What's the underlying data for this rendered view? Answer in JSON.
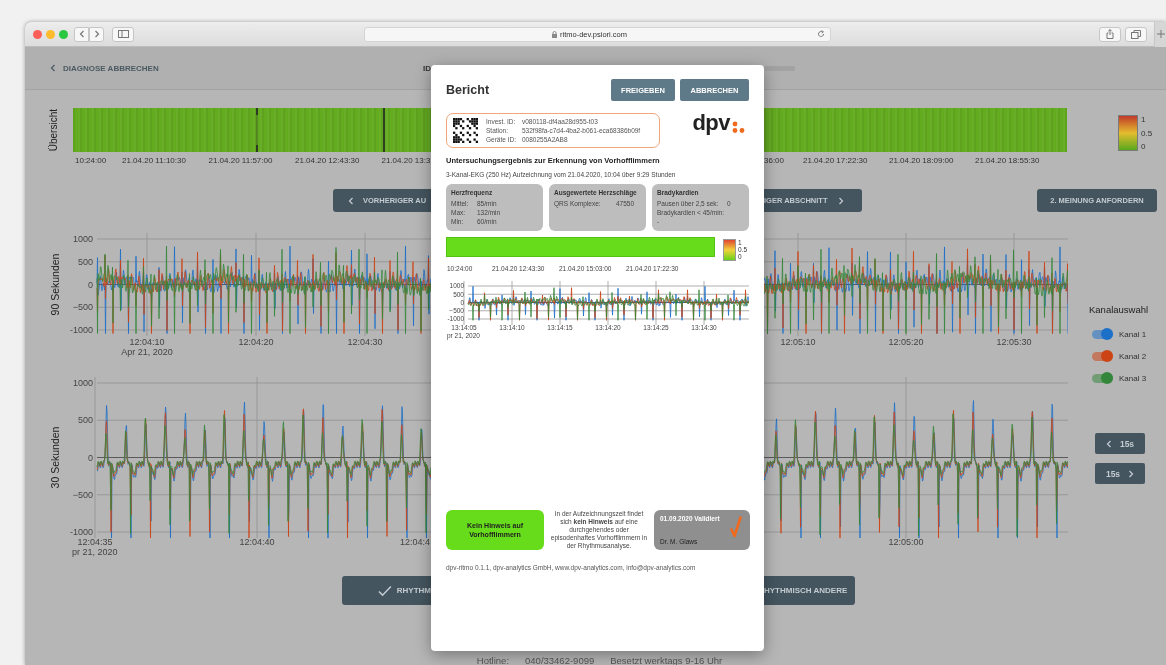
{
  "browser": {
    "url": "ritmo-dev.psiori.com"
  },
  "header": {
    "back_link": "DIAGNOSE ABBRECHEN",
    "id_label": "ID"
  },
  "overview": {
    "label": "Übersicht",
    "time_labels_left": [
      "10:24:00",
      "21.04.20 11:10:30",
      "21.04.20 11:57:00",
      "21.04.20 12:43:30",
      "21.04.20 13:3"
    ],
    "time_labels_right": [
      "36:00",
      "21.04.20 17:22:30",
      "21.04.20 18:09:00",
      "21.04.20 18:55:30"
    ],
    "legend": [
      "1",
      "0.5",
      "0"
    ]
  },
  "navigation": {
    "previous": "VORHERIGER AU",
    "next": "IGER ABSCHNITT",
    "second_opinion": "2. MEINUNG ANFORDERN"
  },
  "charts": [
    {
      "label": "90 Sekunden",
      "yticks": [
        "1000",
        "500",
        "0",
        "−500",
        "-1000"
      ],
      "xlabels_left": [
        "12:04:10",
        "12:04:20",
        "12:04:30"
      ],
      "date_left": "Apr 21, 2020",
      "xlabels_right": [
        "12:05:10",
        "12:05:20",
        "12:05:30"
      ]
    },
    {
      "label": "30 Sekunden",
      "yticks": [
        "1000",
        "500",
        "0",
        "−500",
        "-1000"
      ],
      "xlabels_left": [
        "12:04:35",
        "12:04:40",
        "12:04:4"
      ],
      "date_left": "pr 21, 2020",
      "xlabels_right": [
        "12:05:00"
      ]
    }
  ],
  "channel_select": {
    "title": "Kanalauswahl",
    "channels": [
      {
        "label": "Kanal 1",
        "on": true,
        "color": "#1c70c8"
      },
      {
        "label": "Kanal 2",
        "on": true,
        "color": "#cc4415"
      },
      {
        "label": "Kanal 3",
        "on": true,
        "color": "#34873a"
      }
    ]
  },
  "step_buttons": [
    {
      "label": "15s",
      "kind": "back"
    },
    {
      "label": "15s",
      "kind": "forward"
    }
  ],
  "actions": {
    "confirm": "RHYTHM",
    "other": "HYTHMISCH ANDERE"
  },
  "footer": {
    "hotline_label": "Hotline:",
    "phone": "040/33462-9099",
    "hours": "Besetzt werktags 9-16 Uhr"
  },
  "report": {
    "title": "Bericht",
    "buttons": [
      "FREIGEBEN",
      "ABBRECHEN"
    ],
    "info": [
      {
        "label": "Invest. ID:",
        "value": "v080118-df4aa28d955-t03"
      },
      {
        "label": "Station:",
        "value": "532f98fa-c7d4-4ba2-b061-eca68386b09f"
      },
      {
        "label": "Geräte ID:",
        "value": "0080255A2AB8"
      }
    ],
    "logo": "dpv",
    "heading": "Untersuchungsergebnis zur Erkennung von Vorhofflimmern",
    "subtitle": "3-Kanal-EKG (250 Hz) Aufzeichnung vom 21.04.2020, 10:04 über 9:29 Stunden",
    "cards": [
      {
        "title": "Herzfrequenz",
        "rows": [
          {
            "label": "Mittel:",
            "value": "85/min",
            "kind": "inline"
          },
          {
            "label": "Max:",
            "value": "132/min",
            "kind": "inline"
          },
          {
            "label": "Min:",
            "value": "60/min",
            "kind": "inline"
          }
        ]
      },
      {
        "title": "Ausgewertete Herzschläge",
        "rows": [
          {
            "label": "QRS Komplexe:",
            "value": "47550",
            "kind": "inline"
          }
        ]
      },
      {
        "title": "Bradykardien",
        "rows": [
          {
            "label": "Pausen über 2,5 sek:",
            "value": "0",
            "kind": "inline"
          },
          {
            "label": "Bradykardien < 45/min:",
            "value": "-",
            "kind": "stacked"
          }
        ]
      }
    ],
    "overview": {
      "time_labels": [
        "10:24:00",
        "21.04.20 12:43:30",
        "21.04.20 15:03:00",
        "21.04.20 17:22:30"
      ],
      "legend": [
        "1",
        "0.5",
        "0"
      ]
    },
    "chart": {
      "yticks": [
        "1000",
        "500",
        "0",
        "−500",
        "-1000"
      ],
      "xlabels": [
        "13:14:05",
        "13:14:10",
        "13:14:15",
        "13:14:20",
        "13:14:25",
        "13:14:30"
      ],
      "date": "pr 21, 2020"
    },
    "verdict": "Kein Hinweis auf Vorhofflimmern",
    "explanation": "In der Aufzeichnungszeit findet sich **kein Hinweis** auf eine durchgehendes oder episodenhaftes Vorhofflimmern in der Rhythmusanalyse.",
    "validation": {
      "status": "01.09.2020 Validiert",
      "doctor": "Dr. M. Glaws"
    },
    "footer": "dpv-ritmo 0.1.1, dpv-analytics GmbH, www.dpv-analytics.com, info@dpv-analytics.com"
  }
}
